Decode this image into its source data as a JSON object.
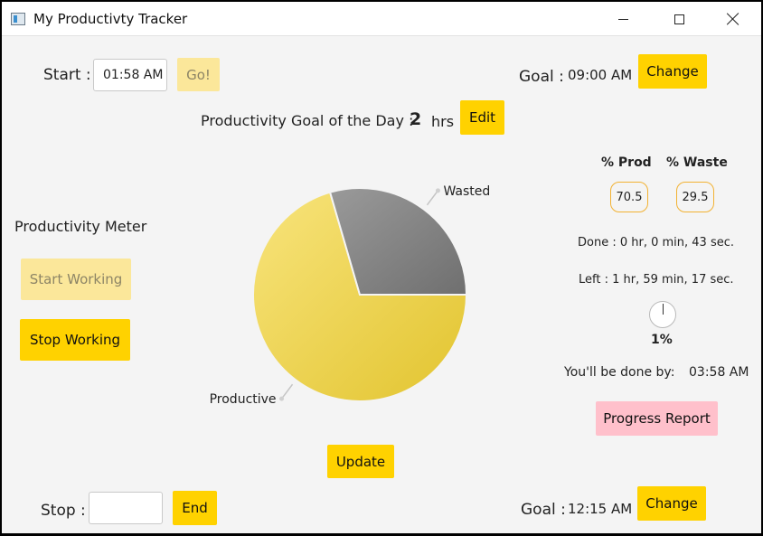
{
  "window": {
    "title": "My Productivty Tracker"
  },
  "start": {
    "label": "Start :",
    "value": "01:58 AM",
    "go_label": "Go!"
  },
  "goal_top": {
    "label": "Goal :",
    "time": "09:00 AM",
    "change_label": "Change"
  },
  "day_goal": {
    "label": "Productivity Goal of the Day :",
    "value": "2",
    "unit": "hrs",
    "edit_label": "Edit"
  },
  "meter": {
    "title": "Productivity Meter",
    "start_working_label": "Start Working",
    "stop_working_label": "Stop Working"
  },
  "stats": {
    "prod_header": "% Prod",
    "waste_header": "% Waste",
    "prod_value": "70.5",
    "waste_value": "29.5",
    "done_text": "Done : 0 hr, 0 min, 43 sec.",
    "left_text": "Left : 1 hr, 59 min, 17 sec.",
    "progress_percent": "1%",
    "done_by_label": "You'll be done by:",
    "done_by_time": "03:58 AM",
    "progress_report_label": "Progress Report"
  },
  "update_label": "Update",
  "stop": {
    "label": "Stop :",
    "value": "",
    "end_label": "End"
  },
  "goal_bottom": {
    "label": "Goal :",
    "time": "12:15 AM",
    "change_label": "Change"
  },
  "chart_data": {
    "type": "pie",
    "slices": [
      {
        "label": "Productive",
        "value": 70.5,
        "color": "#f1d14c"
      },
      {
        "label": "Wasted",
        "value": 29.5,
        "color": "#828282"
      }
    ]
  }
}
